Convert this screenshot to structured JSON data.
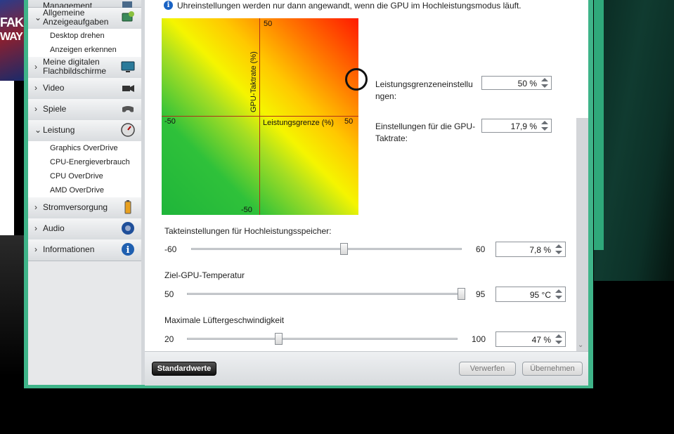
{
  "sidebar": {
    "items": [
      {
        "label": "Management",
        "icon": "monitor-gear-icon"
      },
      {
        "label": "Allgemeine Anzeigeaufgaben",
        "line1": "Allgemeine",
        "line2": "Anzeigeaufgaben",
        "icon": "display-tasks-icon",
        "expanded": true,
        "children": [
          "Desktop drehen",
          "Anzeigen erkennen"
        ]
      },
      {
        "label": "Meine digitalen Flachbildschirme",
        "line1": "Meine digitalen",
        "line2": "Flachbildschirme",
        "icon": "flat-panel-icon"
      },
      {
        "label": "Video",
        "icon": "video-camera-icon"
      },
      {
        "label": "Spiele",
        "icon": "gamepad-icon"
      },
      {
        "label": "Leistung",
        "icon": "gauge-icon",
        "expanded": true,
        "children": [
          "Graphics OverDrive",
          "CPU-Energieverbrauch",
          "CPU OverDrive",
          "AMD OverDrive"
        ]
      },
      {
        "label": "Stromversorgung",
        "icon": "battery-icon"
      },
      {
        "label": "Audio",
        "icon": "speaker-icon"
      },
      {
        "label": "Informationen",
        "icon": "info-icon"
      }
    ]
  },
  "main": {
    "info_text": "Uhreinstellungen werden nur dann angewandt, wenn die GPU im Hochleistungsmodus läuft.",
    "graph": {
      "y_label": "GPU-Taktrate (%)",
      "x_label": "Leistungsgrenze (%)",
      "y_max": "50",
      "y_min": "-50",
      "x_min": "-50",
      "x_max": "50",
      "power_limit_value": 50,
      "gpu_clock_value": 17.9
    },
    "power_limit": {
      "label": "Leistungsgrenzeneinstellungen:",
      "line1": "Leistungsgrenzeneinstellu",
      "line2": "ngen:",
      "value": "50 %"
    },
    "gpu_clock": {
      "label": "Einstellungen für die GPU-Taktrate:",
      "line1": "Einstellungen für die GPU-",
      "line2": "Taktrate:",
      "value": "17,9 %"
    },
    "memory_clock": {
      "label": "Takteinstellungen für Hochleistungsspeicher:",
      "min": "-60",
      "max": "60",
      "value": "7,8 %",
      "level": 7.8
    },
    "target_temp": {
      "label": "Ziel-GPU-Temperatur",
      "min": "50",
      "max": "95",
      "value": "95  °C",
      "level": 95
    },
    "fan_speed": {
      "label": "Maximale Lüftergeschwindigkeit",
      "min": "20",
      "max": "100",
      "value": "47 %",
      "level": 47
    }
  },
  "footer": {
    "defaults_label": "Standardwerte",
    "discard_label": "Verwerfen",
    "apply_label": "Übernehmen"
  },
  "background": {
    "line1": "FAK",
    "line2": "WAY"
  },
  "colors": {
    "window_frame": "#3fb489",
    "info_icon": "#1a63c4"
  }
}
